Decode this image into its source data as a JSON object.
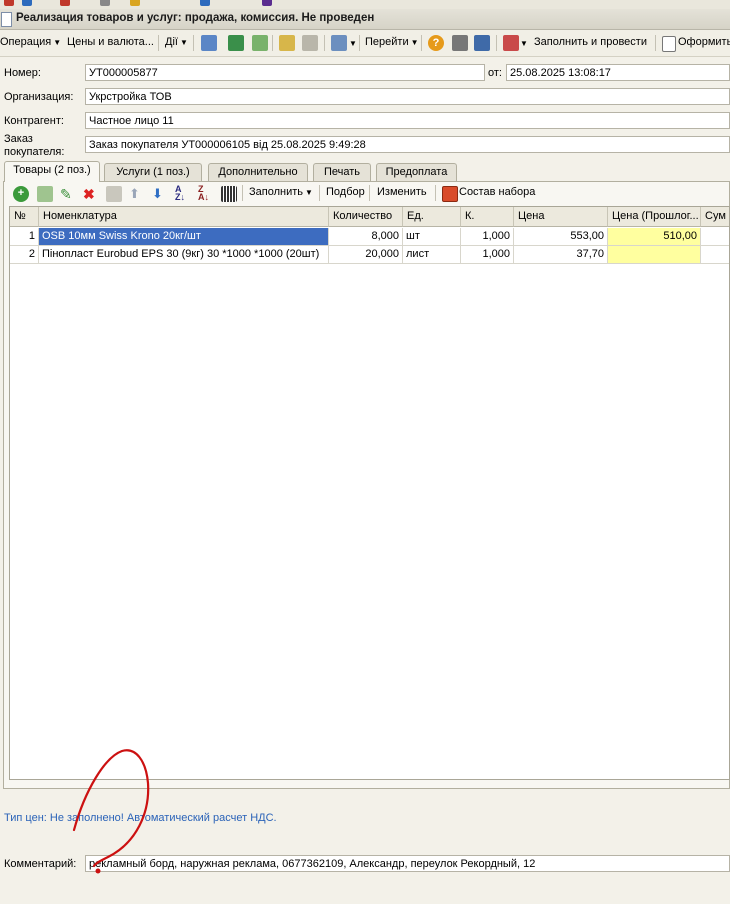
{
  "window": {
    "title": "Реализация товаров и услуг: продажа, комиссия. Не проведен"
  },
  "toolbar": {
    "operation": "Операция",
    "prices": "Цены и валюта...",
    "actions": "Дії",
    "goto": "Перейти",
    "fill_post": "Заполнить и провести",
    "print": "Оформить"
  },
  "form": {
    "number_label": "Номер:",
    "number": "УТ000005877",
    "date_label": "от:",
    "date": "25.08.2025 13:08:17",
    "org_label": "Организация:",
    "org": "Укрстройка ТОВ",
    "contractor_label": "Контрагент:",
    "contractor": "Частное лицо 11",
    "order_label_1": "Заказ",
    "order_label_2": "покупателя:",
    "order": "Заказ покупателя УТ000006105 від 25.08.2025 9:49:28"
  },
  "tabs": [
    "Товары (2 поз.)",
    "Услуги (1 поз.)",
    "Дополнительно",
    "Печать",
    "Предоплата"
  ],
  "inner_toolbar": {
    "fill": "Заполнить",
    "pick": "Подбор",
    "change": "Изменить",
    "kit": "Состав набора"
  },
  "table": {
    "headers": [
      "№",
      "Номенклатура",
      "Количество",
      "Ед.",
      "К.",
      "Цена",
      "Цена (Прошлог...",
      "Сум"
    ],
    "rows": [
      [
        "1",
        "OSB  10мм Swiss Krono 20кг/шт",
        "8,000",
        "шт",
        "1,000",
        "553,00",
        "510,00",
        ""
      ],
      [
        "2",
        "Пінопласт Eurobud EPS 30 (9кг) 30 *1000 *1000 (20шт)",
        "20,000",
        "лист",
        "1,000",
        "37,70",
        "",
        ""
      ]
    ]
  },
  "price_type_info": "Тип цен: Не заполнено! Автоматический расчет НДС.",
  "comment": {
    "label": "Комментарий:",
    "value": "рекламный борд, наружная реклама, 0677362109, Александр, переулок Рекордный, 12"
  },
  "colors": {
    "selection": "#3d6cc0",
    "highlight": "#ffff9f",
    "info_text": "#2b63b8",
    "annotation": "#cc1111"
  }
}
